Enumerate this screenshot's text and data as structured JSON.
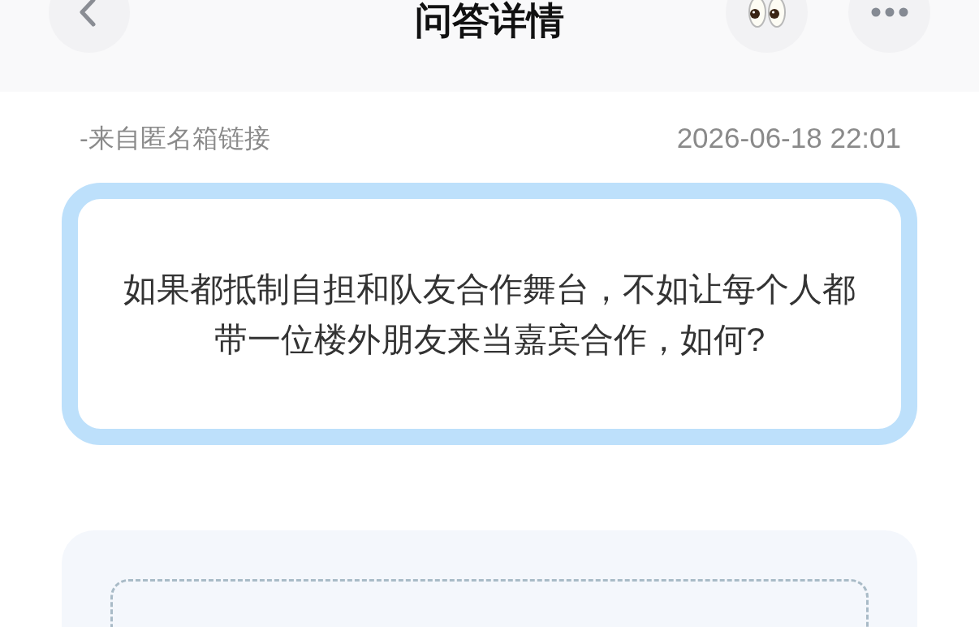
{
  "header": {
    "title": "问答详情"
  },
  "question": {
    "source": "-来自匿名箱链接",
    "time": "2026-06-18 22:01",
    "text": "如果都抵制自担和队友合作舞台，不如让每个人都带一位楼外朋友来当嘉宾合作，如何?"
  }
}
